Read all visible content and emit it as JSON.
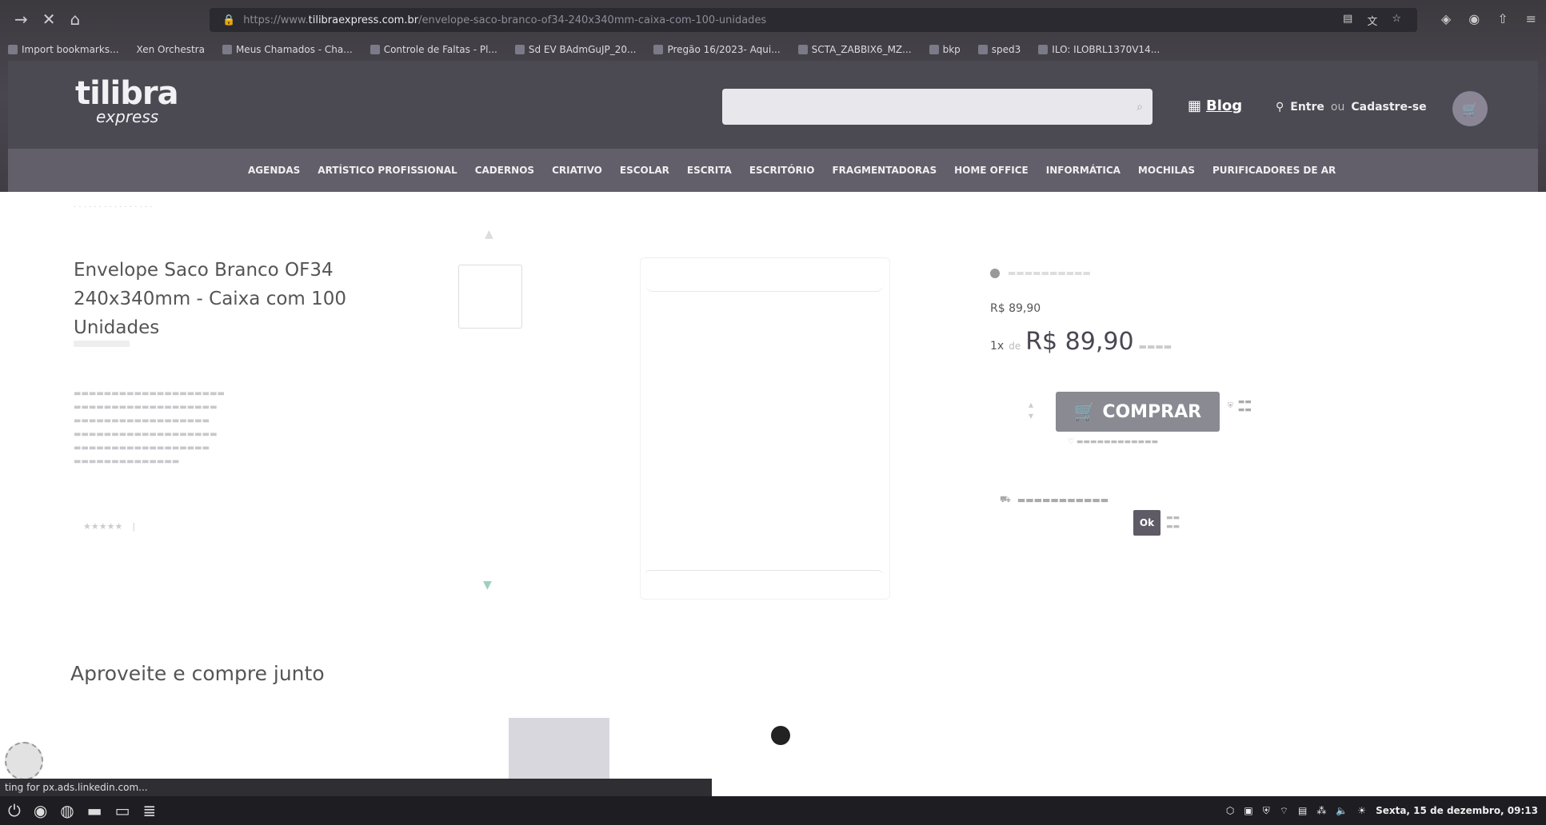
{
  "browser": {
    "url_prefix": "https://www.",
    "url_domain": "tilibraexpress.com.br",
    "url_path": "/envelope-saco-branco-of34-240x340mm-caixa-com-100-unidades",
    "bookmarks": [
      "Import bookmarks...",
      "Xen Orchestra",
      "Meus Chamados - Cha...",
      "Controle de Faltas - Pl...",
      "Sd EV BAdmGuJP_20...",
      "Pregão 16/2023- Aqui...",
      "SCTA_ZABBIX6_MZ...",
      "bkp",
      "sped3",
      "ILO: ILOBRL1370V14..."
    ]
  },
  "site": {
    "logo_main": "tilibra",
    "logo_sub": "express",
    "blog": "Blog",
    "login_enter": "Entre",
    "login_or": "ou",
    "login_register": "Cadastre-se"
  },
  "categories": [
    "AGENDAS",
    "ARTÍSTICO PROFISSIONAL",
    "CADERNOS",
    "CRIATIVO",
    "ESCOLAR",
    "ESCRITA",
    "ESCRITÓRIO",
    "FRAGMENTADORAS",
    "HOME OFFICE",
    "INFORMÁTICA",
    "MOCHILAS",
    "PURIFICADORES DE AR"
  ],
  "product": {
    "title": "Envelope Saco Branco OF34 240x340mm - Caixa com 100 Unidades",
    "price_old": "R$ 89,90",
    "installments_prefix": "1x",
    "installments_de": "de",
    "price_main": "R$ 89,90",
    "buy_label": "COMPRAR",
    "ok_label": "Ok"
  },
  "section": {
    "buy_together": "Aproveite e compre junto"
  },
  "status_bar": "ting for px.ads.linkedin.com...",
  "taskbar": {
    "clock": "Sexta, 15 de dezembro, 09:13"
  }
}
